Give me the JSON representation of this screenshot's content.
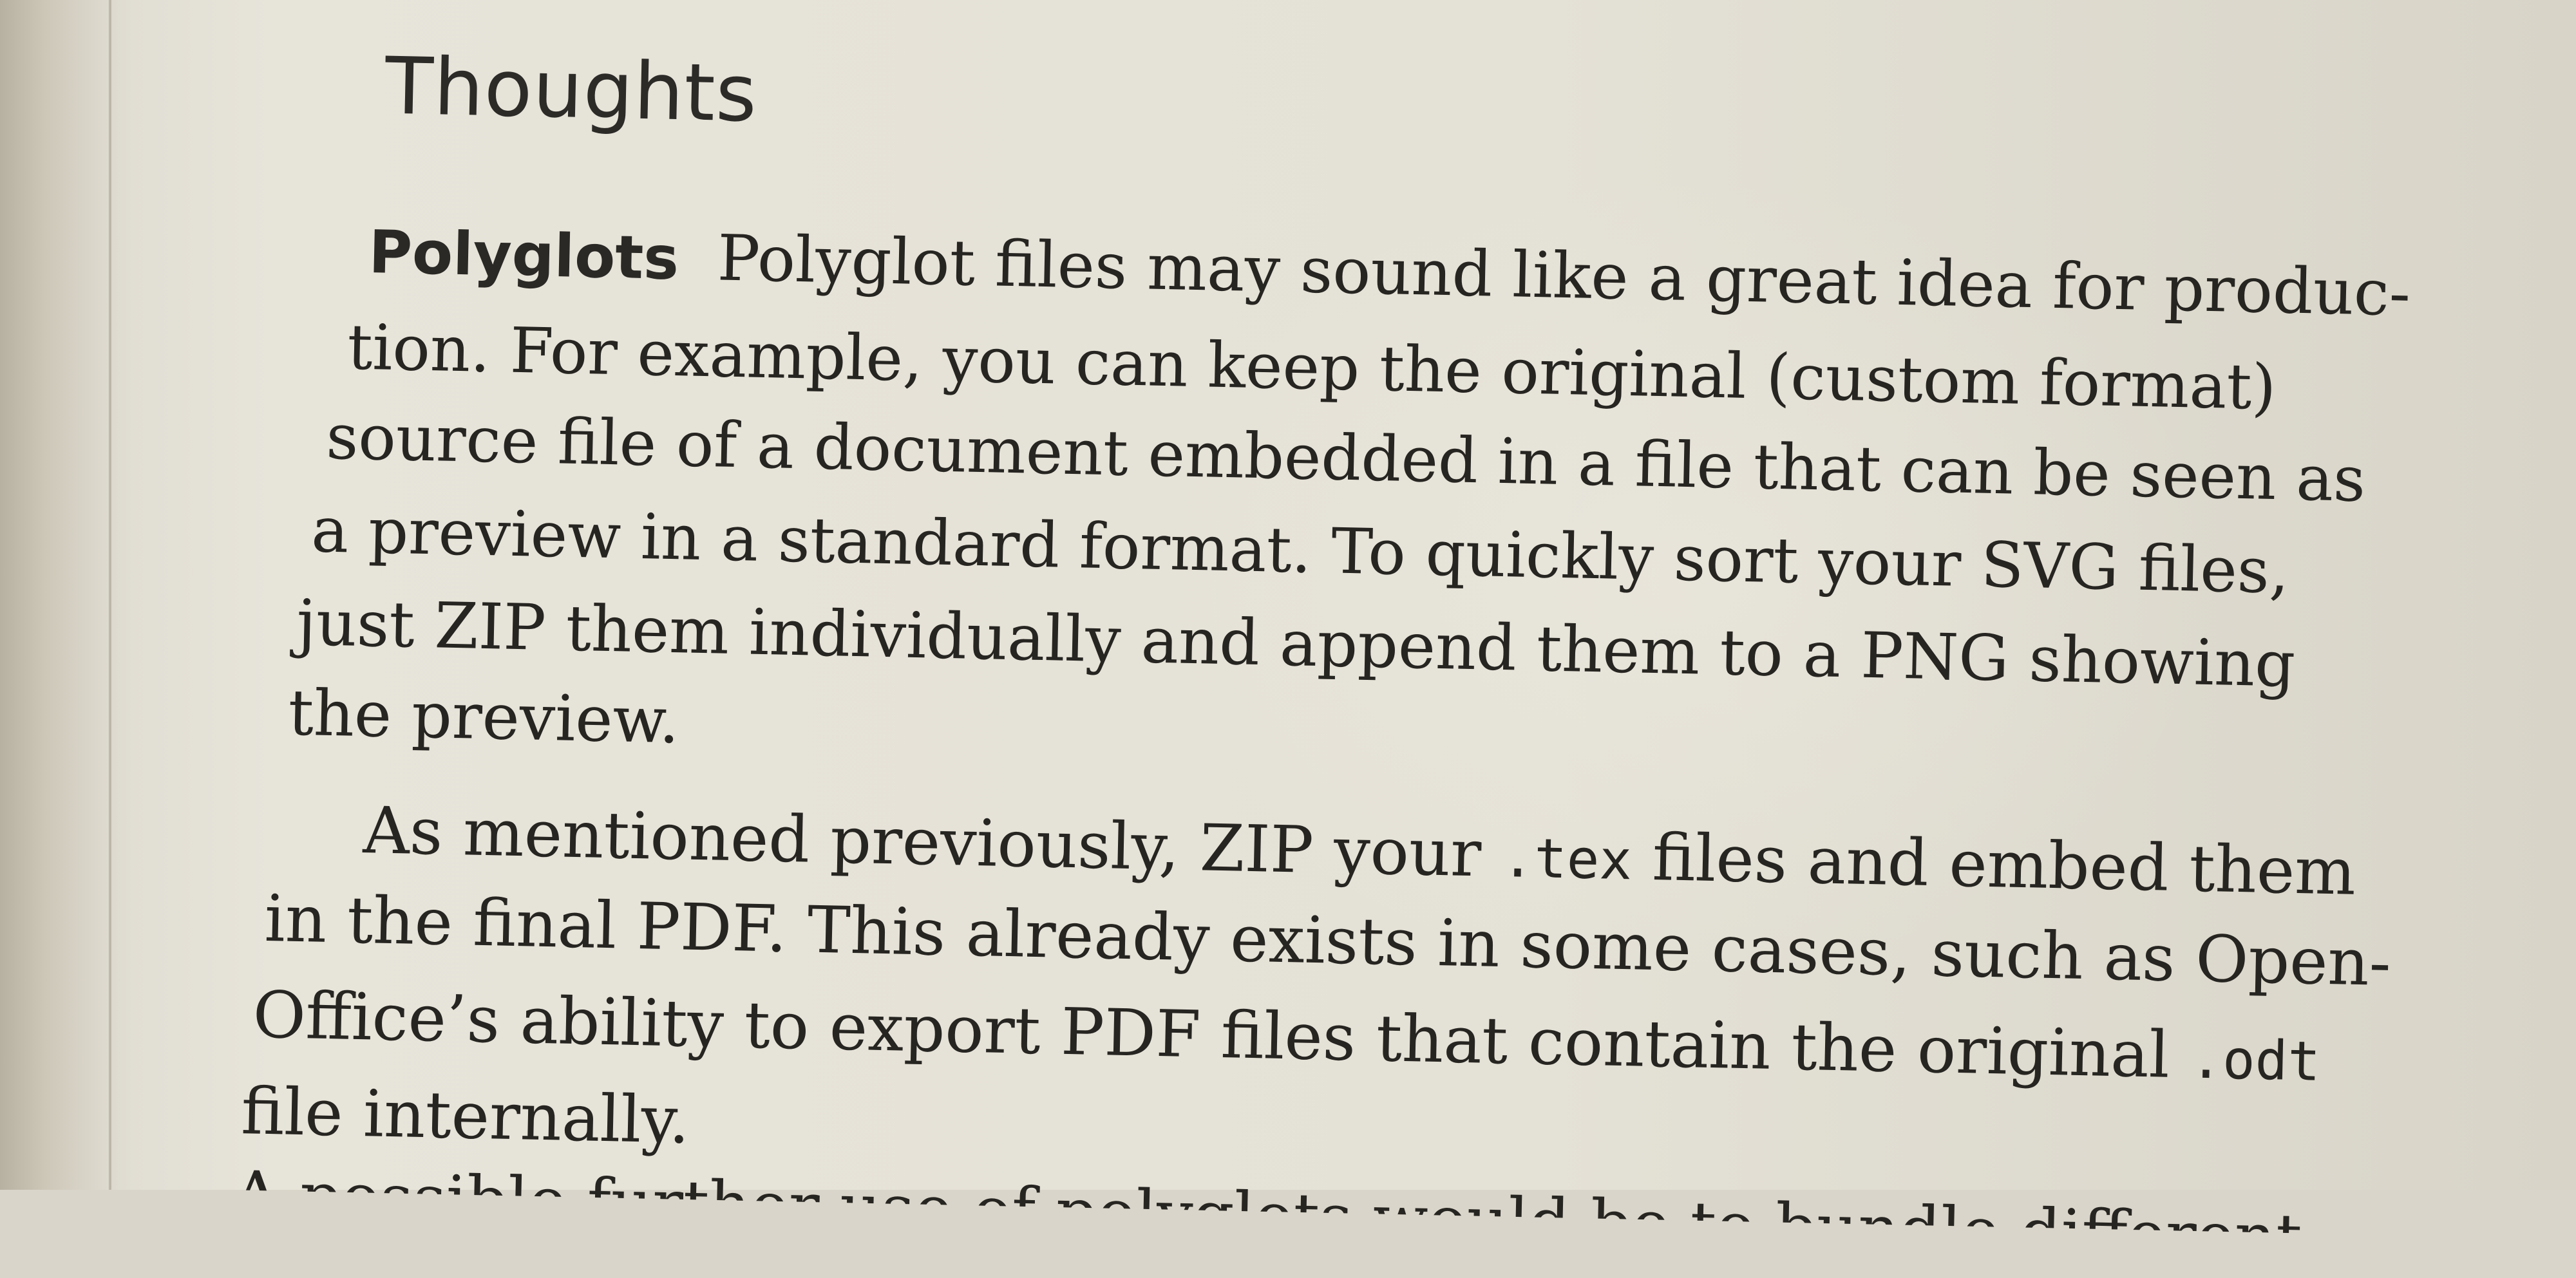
{
  "heading": "Thoughts",
  "paragraph1": {
    "run_in": "Polyglots",
    "lines": [
      "Polyglot files may sound like a great idea for produc-",
      "tion.  For example, you can keep the original (custom format)",
      "source file of a document embedded in a file that can be seen as",
      "a preview in a standard format. To quickly sort your SVG files,",
      "just ZIP them individually and append them to a PNG showing",
      "the preview."
    ]
  },
  "paragraph2": {
    "line1_a": "As mentioned previously, ZIP your ",
    "line1_code": ".tex",
    "line1_b": " files and embed them",
    "line2": "in the final PDF. This already exists in some cases, such as Open-",
    "line3_a": "Office’s ability to export PDF files that contain the original ",
    "line3_code": ".odt",
    "line4": "file internally."
  },
  "partial_line": "A possible further use of polyglots would be to bundle different"
}
